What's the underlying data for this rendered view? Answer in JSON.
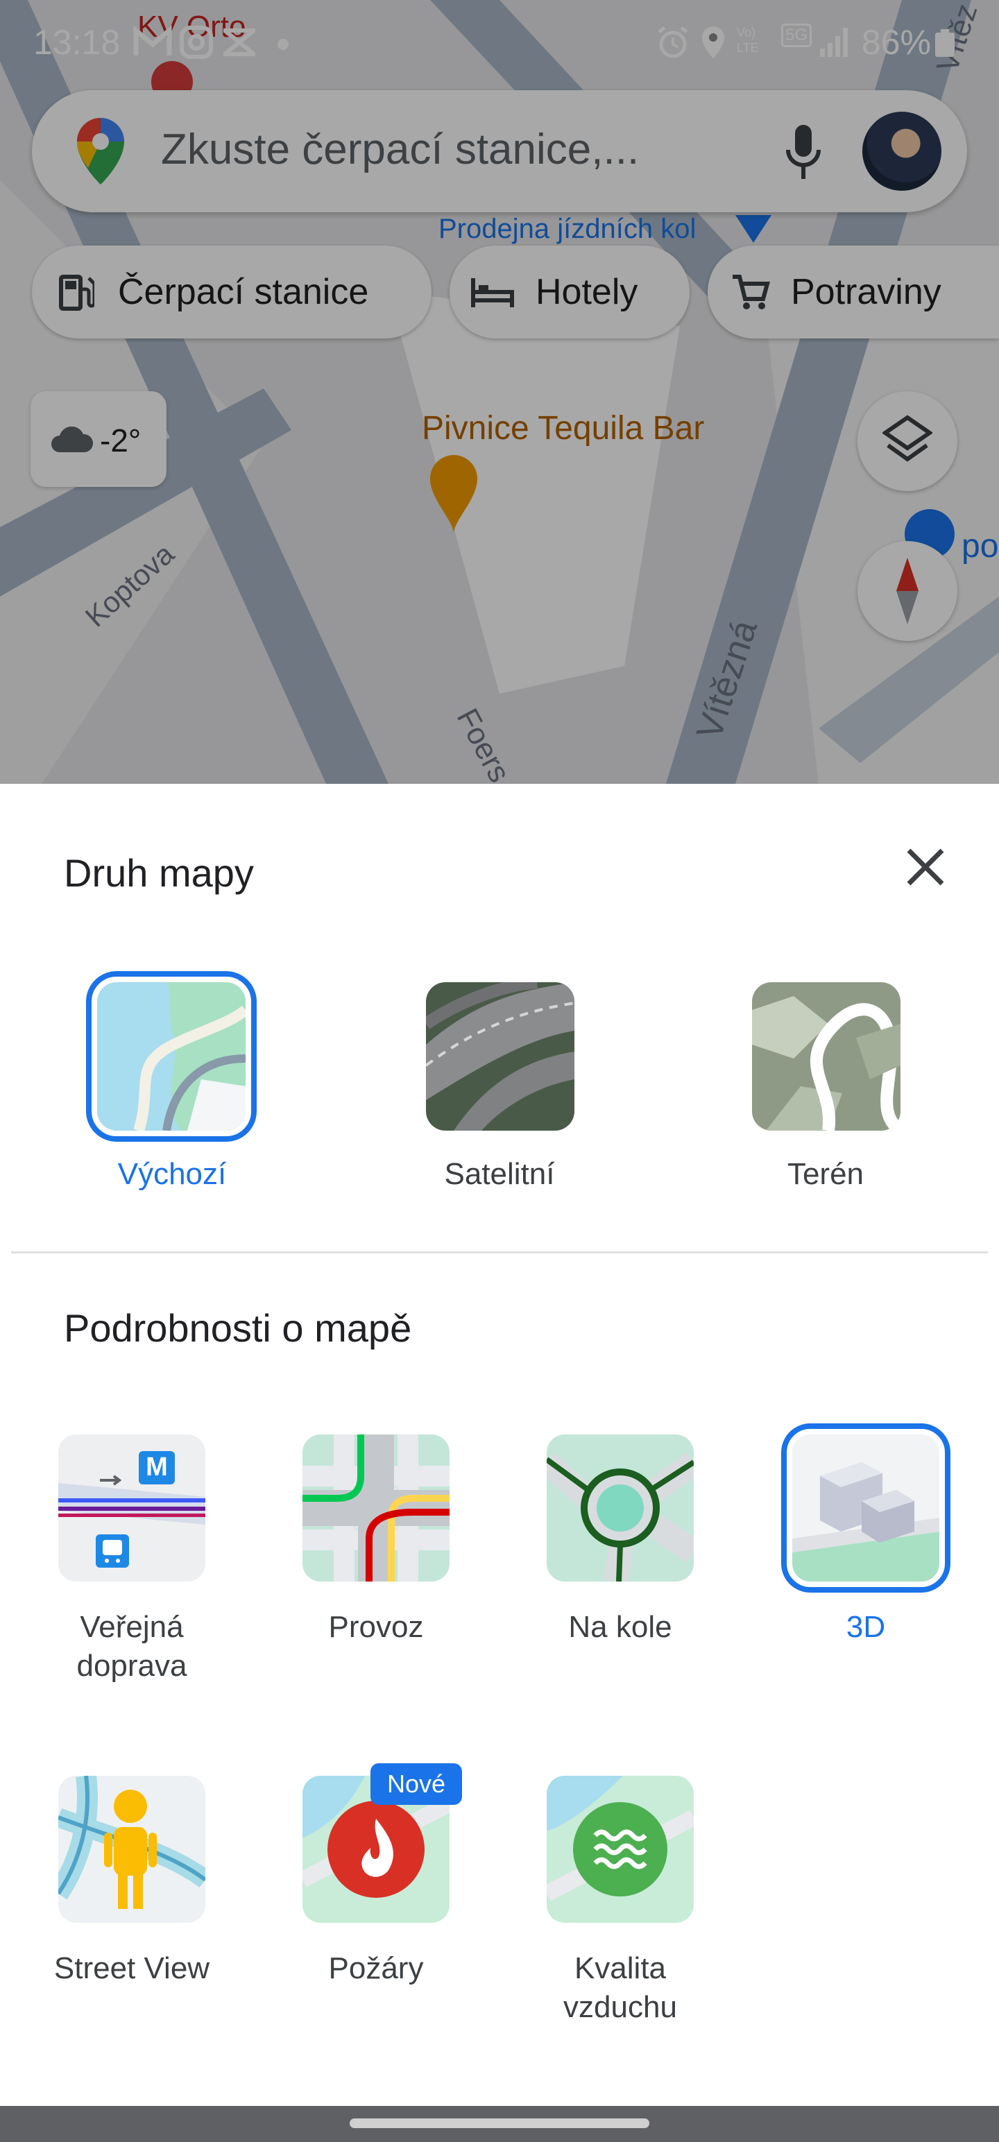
{
  "status_bar": {
    "time": "13:18",
    "battery": "86%",
    "network_label": "5G",
    "lte_label": "Vo) LTE"
  },
  "map": {
    "labels": {
      "kv_orto": "KV Orto",
      "bike_shop": "Prodejna jízdních kol",
      "bar": "Pivnice Tequila Bar",
      "street_koptova": "Koptova",
      "street_vitezna": "Vítězná",
      "street_foers": "Foers",
      "poi_partial": "po",
      "street_partial_top": "Vítěz"
    },
    "search": {
      "placeholder": "Zkuste čerpací stanice,..."
    },
    "chips": [
      {
        "label": "Čerpací stanice",
        "icon": "gas-station-icon"
      },
      {
        "label": "Hotely",
        "icon": "bed-icon"
      },
      {
        "label": "Potraviny",
        "icon": "cart-icon"
      }
    ],
    "weather": {
      "temp": "-2°",
      "icon": "cloud-icon"
    }
  },
  "sheet": {
    "map_type_title": "Druh mapy",
    "map_types": [
      {
        "label": "Výchozí",
        "selected": true
      },
      {
        "label": "Satelitní",
        "selected": false
      },
      {
        "label": "Terén",
        "selected": false
      }
    ],
    "details_title": "Podrobnosti o mapě",
    "details": [
      {
        "label_line1": "Veřejná",
        "label_line2": "doprava",
        "selected": false
      },
      {
        "label_line1": "Provoz",
        "label_line2": "",
        "selected": false
      },
      {
        "label_line1": "Na kole",
        "label_line2": "",
        "selected": false
      },
      {
        "label_line1": "3D",
        "label_line2": "",
        "selected": true
      },
      {
        "label_line1": "Street View",
        "label_line2": "",
        "selected": false
      },
      {
        "label_line1": "Požáry",
        "label_line2": "",
        "selected": false
      },
      {
        "label_line1": "Kvalita",
        "label_line2": "vzduchu",
        "selected": false
      }
    ],
    "new_badge": "Nové",
    "metro_letter": "M"
  },
  "colors": {
    "accent": "#1a73e8",
    "bar_label": "#b06000",
    "bike_label": "#1a73e8"
  }
}
